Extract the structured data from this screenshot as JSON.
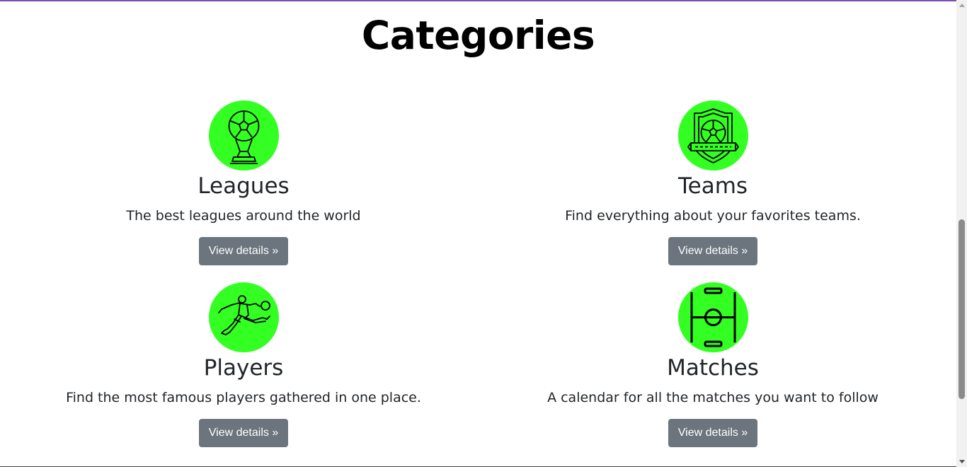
{
  "page": {
    "title": "Categories"
  },
  "colors": {
    "icon_bg": "#33ff22",
    "button_bg": "#6c757d",
    "accent_border": "#7b4fb5"
  },
  "categories": [
    {
      "title": "Leagues",
      "text": "The best leagues around the world",
      "button": "View details »",
      "icon": "trophy-ball-icon"
    },
    {
      "title": "Teams",
      "text": "Find everything about your favorites teams.",
      "button": "View details »",
      "icon": "team-shield-icon"
    },
    {
      "title": "Players",
      "text": "Find the most famous players gathered in one place.",
      "button": "View details »",
      "icon": "player-kick-icon"
    },
    {
      "title": "Matches",
      "text": "A calendar for all the matches you want to follow",
      "button": "View details »",
      "icon": "football-pitch-icon"
    }
  ]
}
